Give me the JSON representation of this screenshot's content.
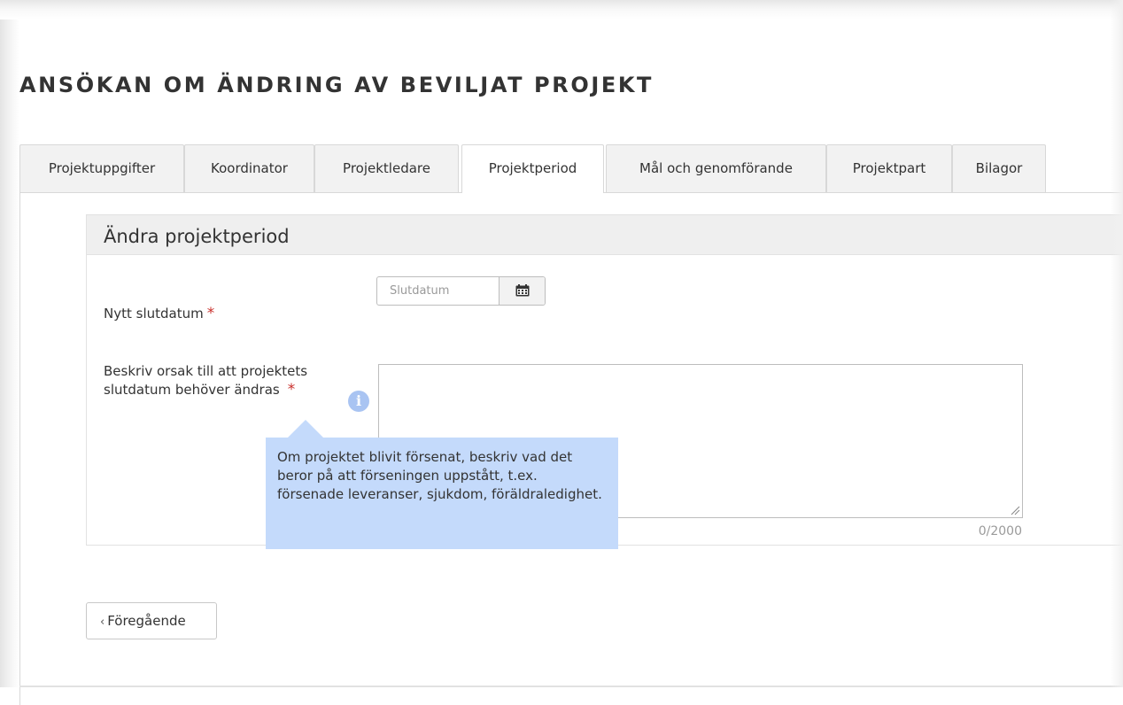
{
  "page": {
    "title": "ANSÖKAN OM ÄNDRING AV BEVILJAT PROJEKT"
  },
  "tabs": [
    {
      "label": "Projektuppgifter"
    },
    {
      "label": "Koordinator"
    },
    {
      "label": "Projektledare"
    },
    {
      "label": "Projektperiod",
      "active": true
    },
    {
      "label": "Mål och genomförande"
    },
    {
      "label": "Projektpart"
    },
    {
      "label": "Bilagor"
    }
  ],
  "panel": {
    "title": "Ändra projektperiod",
    "end_date": {
      "label": "Nytt slutdatum",
      "required_mark": "*",
      "placeholder": "Slutdatum",
      "button_icon": "calendar-icon"
    },
    "reason": {
      "label_line1": "Beskriv orsak till att projektets",
      "label_line2": "slutdatum behöver ändras",
      "required_mark": "*",
      "info_icon": "info-icon",
      "info_glyph": "i",
      "counter": "0/2000",
      "tooltip": "Om projektet blivit försenat, beskriv vad det beror på att förseningen uppstått, t.ex. försenade leveranser, sjukdom, föräldraledighet."
    }
  },
  "footer": {
    "prev_label": "Föregående",
    "prev_chevron": "‹"
  },
  "colors": {
    "required": "#c9302c",
    "tooltip_bg": "#c4dafb",
    "info_icon": "#a9c4f2",
    "tab_bg": "#f2f2f2",
    "panel_header_bg": "#efefef"
  }
}
